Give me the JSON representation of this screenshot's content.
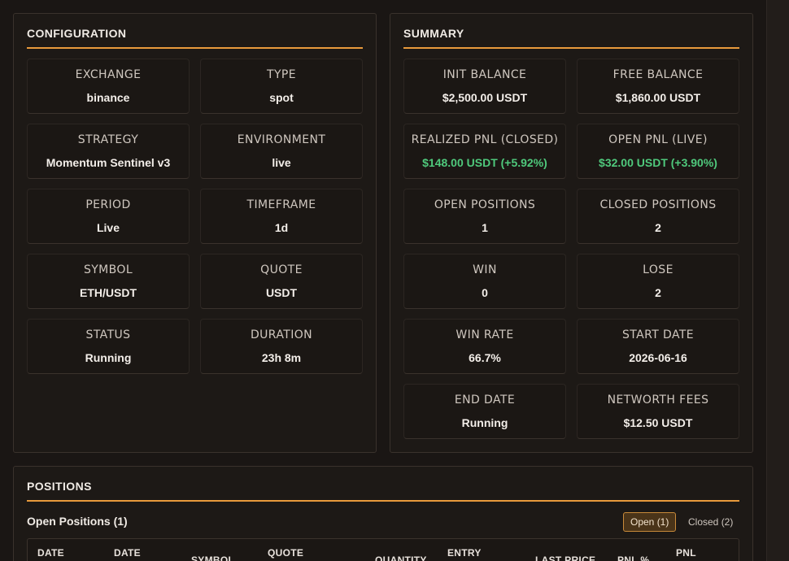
{
  "configuration": {
    "title": "CONFIGURATION",
    "cards": [
      {
        "label": "EXCHANGE",
        "value": "binance"
      },
      {
        "label": "TYPE",
        "value": "spot"
      },
      {
        "label": "STRATEGY",
        "value": "Momentum Sentinel v3"
      },
      {
        "label": "ENVIRONMENT",
        "value": "live"
      },
      {
        "label": "PERIOD",
        "value": "Live"
      },
      {
        "label": "TIMEFRAME",
        "value": "1d"
      },
      {
        "label": "SYMBOL",
        "value": "ETH/USDT"
      },
      {
        "label": "QUOTE",
        "value": "USDT"
      },
      {
        "label": "STATUS",
        "value": "Running"
      },
      {
        "label": "DURATION",
        "value": "23h 8m"
      }
    ]
  },
  "summary": {
    "title": "SUMMARY",
    "cards": [
      {
        "label": "INIT BALANCE",
        "value": "$2,500.00 USDT"
      },
      {
        "label": "FREE BALANCE",
        "value": "$1,860.00 USDT"
      },
      {
        "label": "REALIZED PNL (CLOSED)",
        "value": "$148.00 USDT (+5.92%)"
      },
      {
        "label": "OPEN PNL (LIVE)",
        "value": "$32.00 USDT (+3.90%)"
      },
      {
        "label": "OPEN POSITIONS",
        "value": "1"
      },
      {
        "label": "CLOSED POSITIONS",
        "value": "2"
      },
      {
        "label": "WIN",
        "value": "0"
      },
      {
        "label": "LOSE",
        "value": "2"
      },
      {
        "label": "WIN RATE",
        "value": "66.7%"
      },
      {
        "label": "START DATE",
        "value": "2026-06-16"
      },
      {
        "label": "END DATE",
        "value": "Running"
      },
      {
        "label": "NETWORTH FEES",
        "value": "$12.50 USDT"
      }
    ]
  },
  "positions": {
    "title": "POSITIONS",
    "subtitle": "Open Positions (1)",
    "tab_open": "Open (1)",
    "tab_closed": "Closed (2)",
    "columns": [
      "DATE",
      "DATE",
      "SYMBOL",
      "QUOTE",
      "QUANTITY",
      "ENTRY",
      "LAST PRICE",
      "PNL %",
      "PNL"
    ]
  },
  "colors": {
    "accent": "#e89a3c",
    "positive": "#4fc97c",
    "background": "#1a1614",
    "panel": "#1d1916"
  }
}
